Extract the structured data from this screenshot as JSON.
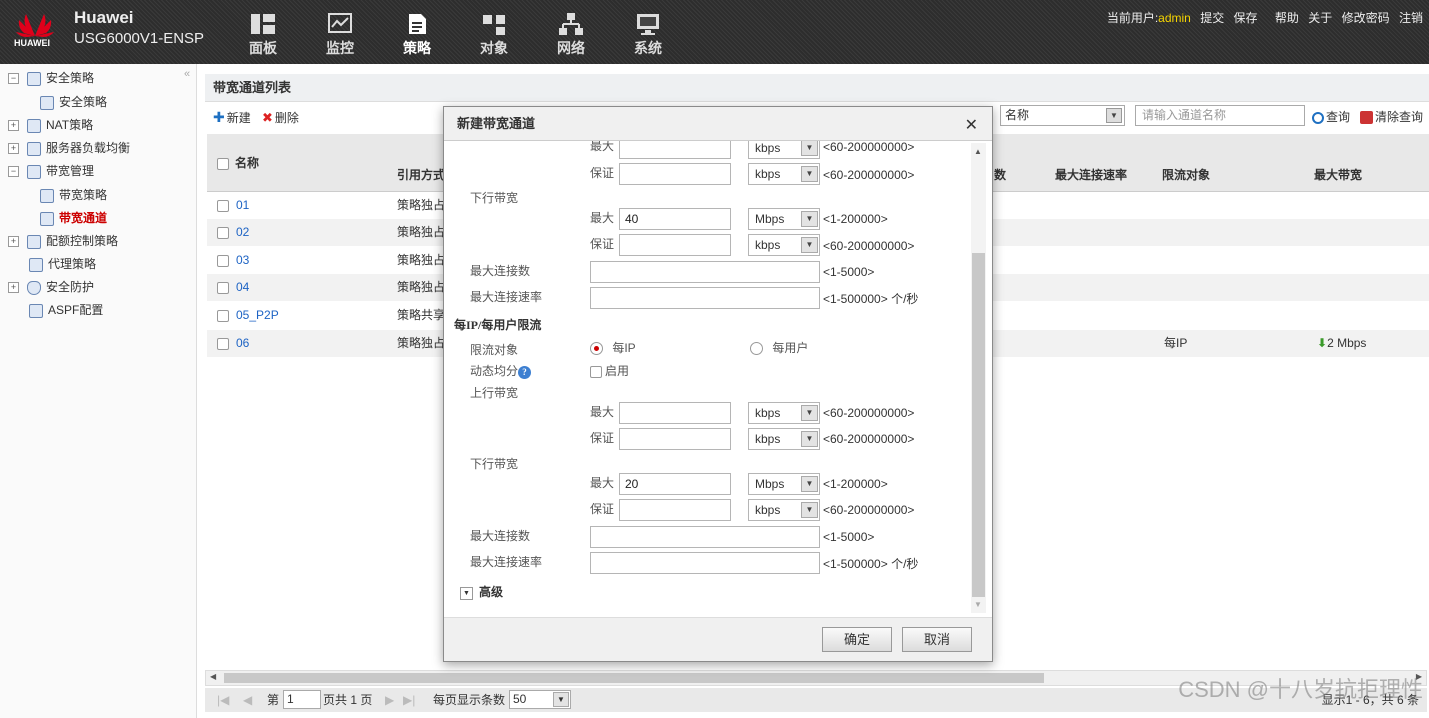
{
  "header": {
    "brand": "Huawei",
    "model": "USG6000V1-ENSP",
    "logo_text": "HUAWEI",
    "nav": [
      {
        "label": "面板",
        "icon": "dashboard-icon"
      },
      {
        "label": "监控",
        "icon": "monitor-icon"
      },
      {
        "label": "策略",
        "icon": "policy-icon"
      },
      {
        "label": "对象",
        "icon": "object-icon"
      },
      {
        "label": "网络",
        "icon": "network-icon"
      },
      {
        "label": "系统",
        "icon": "system-icon"
      }
    ],
    "current_user_label": "当前用户:",
    "username": "admin",
    "actions": [
      "提交",
      "保存",
      "帮助",
      "关于",
      "修改密码",
      "注销"
    ]
  },
  "sidebar": {
    "items": [
      {
        "label": "安全策略",
        "exp": "−"
      },
      {
        "label": "安全策略"
      },
      {
        "label": "NAT策略",
        "exp": "+"
      },
      {
        "label": "服务器负载均衡",
        "exp": "+"
      },
      {
        "label": "带宽管理",
        "exp": "−"
      },
      {
        "label": "带宽策略"
      },
      {
        "label": "带宽通道"
      },
      {
        "label": "配额控制策略",
        "exp": "+"
      },
      {
        "label": "代理策略"
      },
      {
        "label": "安全防护",
        "exp": "+"
      },
      {
        "label": "ASPF配置"
      }
    ]
  },
  "main": {
    "title": "带宽通道列表",
    "toolbar": {
      "new": "新建",
      "delete": "删除",
      "search_field": "名称",
      "search_placeholder": "请输入通道名称",
      "query": "查询",
      "clear": "清除查询"
    },
    "columns": {
      "name": "名称",
      "ref": "引用方式",
      "max_conn": "数",
      "max_rate": "最大连接速率",
      "target": "限流对象",
      "max_bw": "最大带宽"
    },
    "rows": [
      {
        "name": "01",
        "ref": "策略独占",
        "target": "",
        "bw": ""
      },
      {
        "name": "02",
        "ref": "策略独占",
        "target": "",
        "bw": ""
      },
      {
        "name": "03",
        "ref": "策略独占",
        "target": "",
        "bw": ""
      },
      {
        "name": "04",
        "ref": "策略独占",
        "target": "",
        "bw": ""
      },
      {
        "name": "05_P2P",
        "ref": "策略共享",
        "target": "",
        "bw": ""
      },
      {
        "name": "06",
        "ref": "策略独占",
        "target": "每IP",
        "bw": "2 Mbps"
      }
    ],
    "pager": {
      "page_label": "第",
      "page": "1",
      "of": "页共 1 页",
      "per_page_label": "每页显示条数",
      "per_page": "50",
      "summary": "显示1 - 6，共 6 条"
    }
  },
  "dialog": {
    "title": "新建带宽通道",
    "labels": {
      "max": "最大",
      "guarantee": "保证",
      "downlink": "下行带宽",
      "uplink": "上行带宽",
      "max_conn": "最大连接数",
      "max_conn_rate": "最大连接速率",
      "per_section": "每IP/每用户限流",
      "limit_target": "限流对象",
      "per_ip": "每IP",
      "per_user": "每用户",
      "dyn_share": "动态均分",
      "enable": "启用",
      "advanced": "高级"
    },
    "ranges": {
      "kbps": "<60-200000000>",
      "mbps": "<1-200000>",
      "conn": "<1-5000>",
      "rate": "<1-500000>",
      "rate_unit": "个/秒"
    },
    "units": {
      "kbps": "kbps",
      "mbps": "Mbps"
    },
    "values": {
      "whole_down_max": "40",
      "per_down_max": "20"
    },
    "buttons": {
      "ok": "确定",
      "cancel": "取消"
    }
  },
  "watermark": "CSDN @十八岁抗拒理性"
}
